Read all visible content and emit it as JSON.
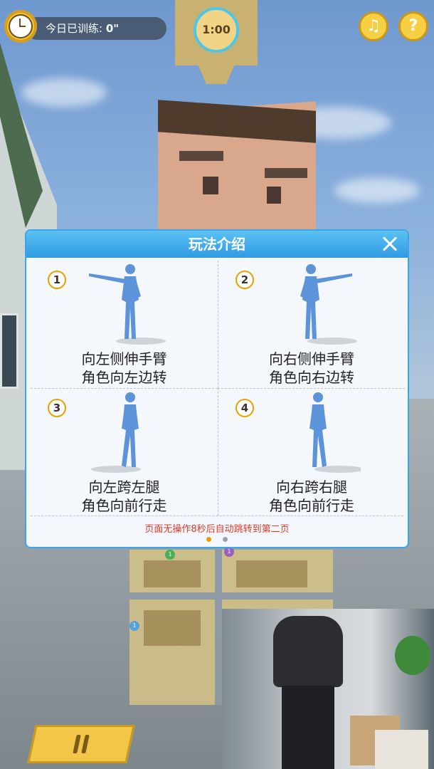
{
  "header": {
    "training_label": "今日已训练:",
    "training_value": "0\"",
    "timer": "1:00",
    "music_icon": "music-note-icon",
    "help_label": "?"
  },
  "modal": {
    "title": "玩法介绍",
    "close_icon": "close-icon",
    "steps": [
      {
        "number": "1",
        "line1": "向左侧伸手臂",
        "line2": "角色向左边转",
        "pose": "left-arm-raised"
      },
      {
        "number": "2",
        "line1": "向右侧伸手臂",
        "line2": "角色向右边转",
        "pose": "right-arm-raised"
      },
      {
        "number": "3",
        "line1": "向左跨左腿",
        "line2": "角色向前行走",
        "pose": "left-leg-step"
      },
      {
        "number": "4",
        "line1": "向右跨右腿",
        "line2": "角色向前行走",
        "pose": "right-leg-step"
      }
    ],
    "hint": "页面无操作8秒后自动跳转到第二页",
    "page_dots": [
      {
        "active": true
      },
      {
        "active": false
      }
    ]
  },
  "map": {
    "badges": [
      "1",
      "1",
      "1"
    ]
  },
  "controls": {
    "pause_icon": "pause-icon"
  },
  "colors": {
    "accent_blue": "#3aa5ea",
    "gold": "#f6cf42",
    "hint_red": "#e03a2a",
    "figure_blue": "#5d93d8"
  }
}
